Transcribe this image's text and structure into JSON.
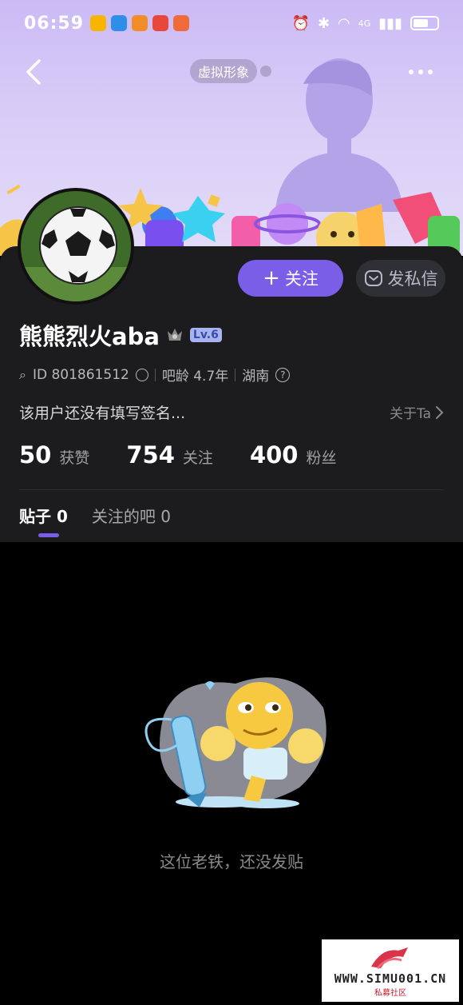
{
  "status_bar": {
    "time": "06:59",
    "network_label": "4G"
  },
  "header": {
    "avatar_chip_label": "虚拟形象"
  },
  "profile": {
    "name": "熊熊烈火aba",
    "level": "Lv.6",
    "id_label": "ID 801861512",
    "bar_age": "吧龄 4.7年",
    "location": "湖南",
    "bio": "该用户还没有填写签名...",
    "about_label": "关于Ta"
  },
  "actions": {
    "follow_label": "关注",
    "message_label": "发私信"
  },
  "stats": [
    {
      "value": "50",
      "label": "获赞"
    },
    {
      "value": "754",
      "label": "关注"
    },
    {
      "value": "400",
      "label": "粉丝"
    }
  ],
  "tabs": [
    {
      "label": "贴子 0",
      "active": true
    },
    {
      "label": "关注的吧 0",
      "active": false
    }
  ],
  "empty_state": {
    "message": "这位老铁，还没发贴"
  },
  "watermark": {
    "text": "WWW.SIMU001.CN",
    "sub": "私募社区"
  },
  "colors": {
    "accent": "#7b5ee8",
    "panel_bg": "#1c1c1e",
    "banner_bg": "#d9cdf7"
  }
}
